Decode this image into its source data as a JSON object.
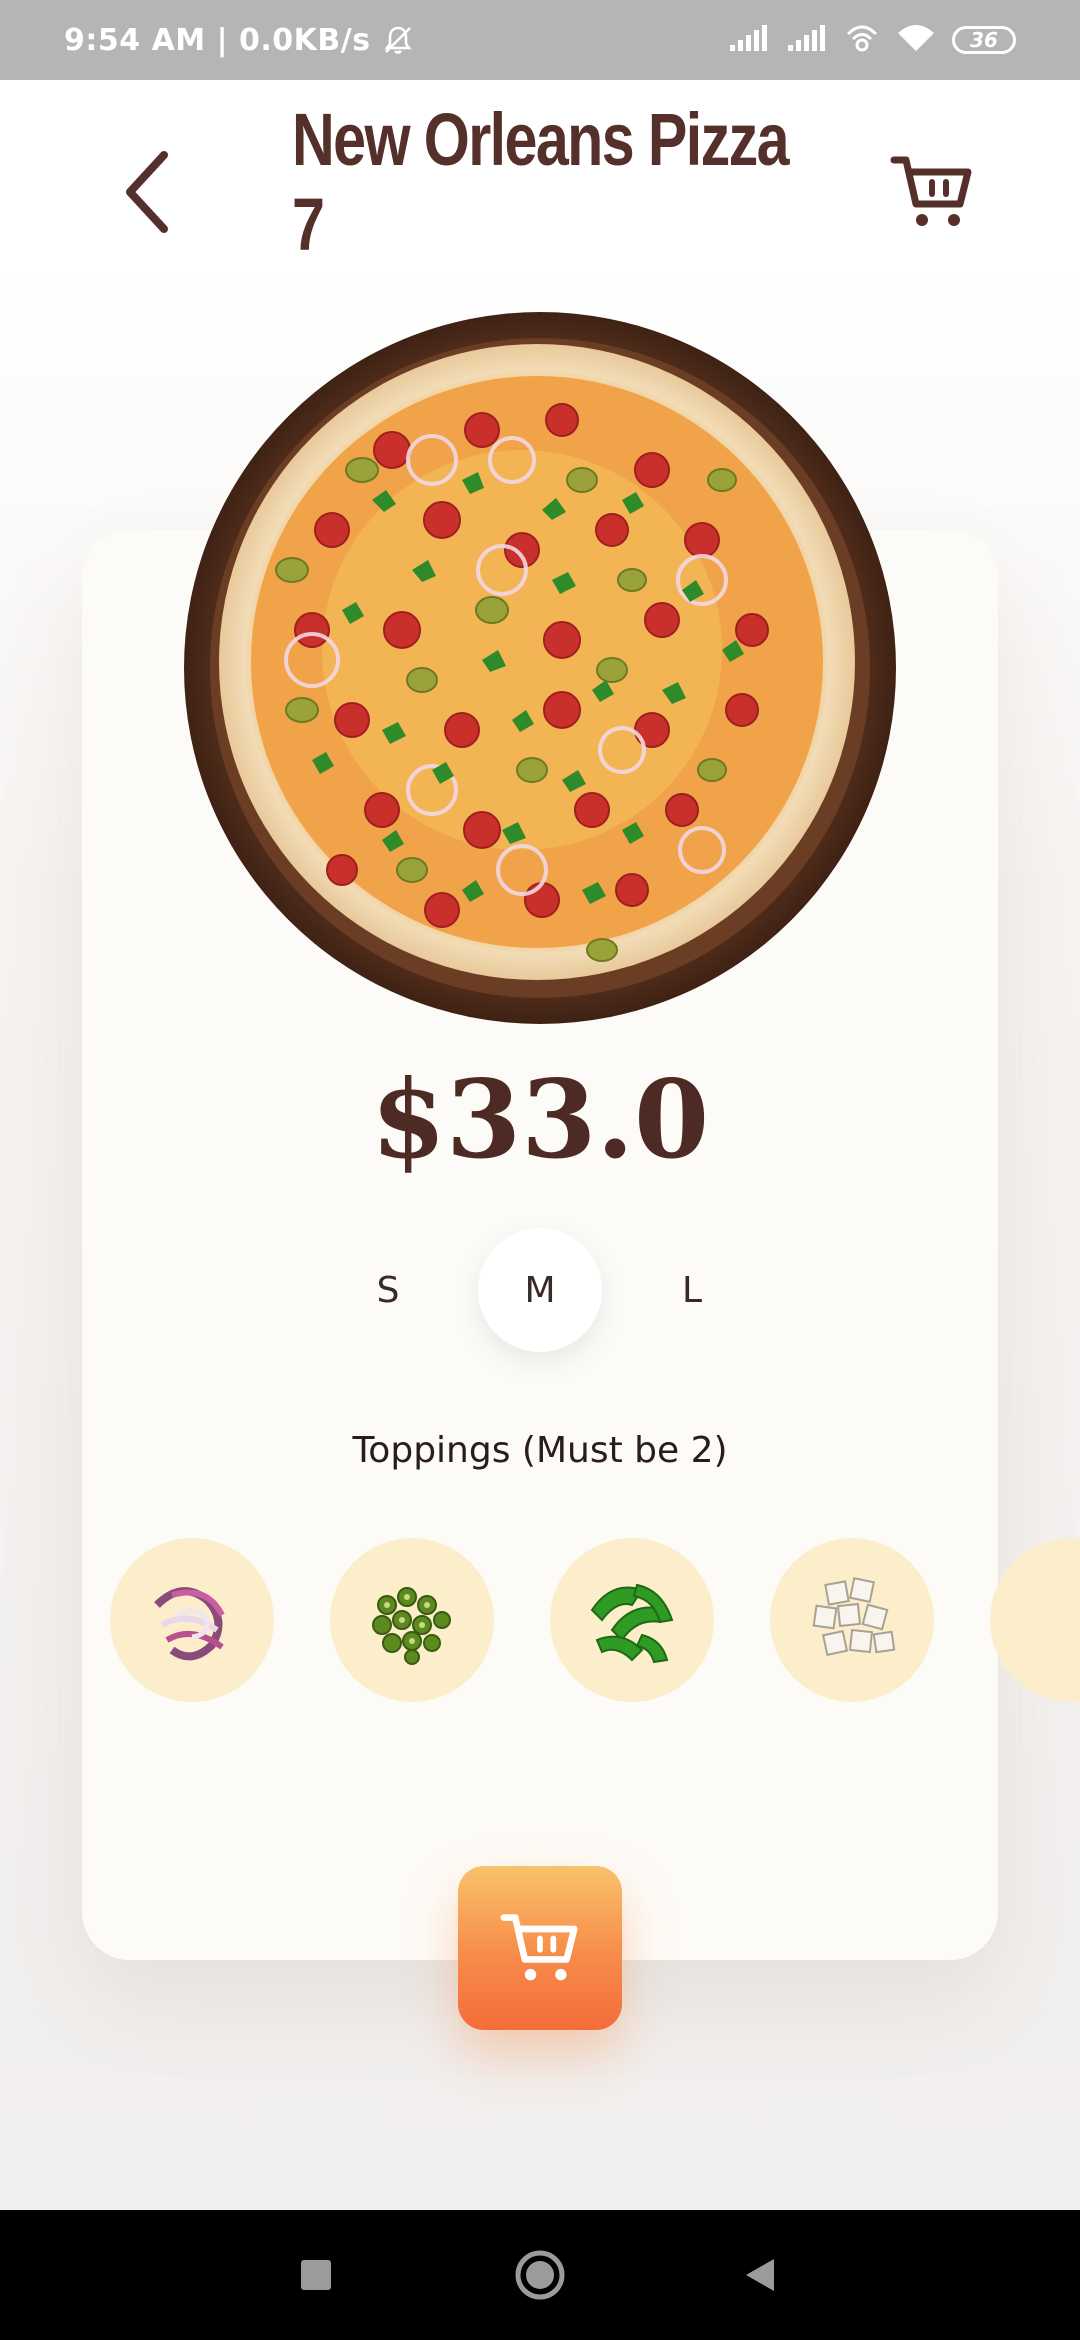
{
  "status_bar": {
    "time_speed": "9:54 AM | 0.0KB/s",
    "battery": "36",
    "icons": [
      "bell-off-icon",
      "signal-icon",
      "signal-icon",
      "hotspot-icon",
      "wifi-icon",
      "battery-icon"
    ]
  },
  "header": {
    "title": "New Orleans Pizza 7",
    "back_icon": "chevron-left-icon",
    "cart_icon": "cart-icon"
  },
  "product": {
    "image": "pizza-image",
    "price": "$33.0",
    "sizes": [
      "S",
      "M",
      "L"
    ],
    "selected_size": "M",
    "toppings_label": "Toppings (Must be 2)",
    "toppings": [
      "red-onion",
      "green-chili",
      "green-pepper",
      "paneer"
    ]
  },
  "actions": {
    "add_to_cart_icon": "cart-icon"
  },
  "colors": {
    "brand_brown": "#55302a",
    "card_bg": "#fdfbf7",
    "topping_bg": "#fcedcb",
    "button_gradient_top": "#f9c26a",
    "button_gradient_bottom": "#f46d3c"
  },
  "nav_bar": {
    "buttons": [
      "recents-icon",
      "home-icon",
      "back-icon"
    ]
  }
}
